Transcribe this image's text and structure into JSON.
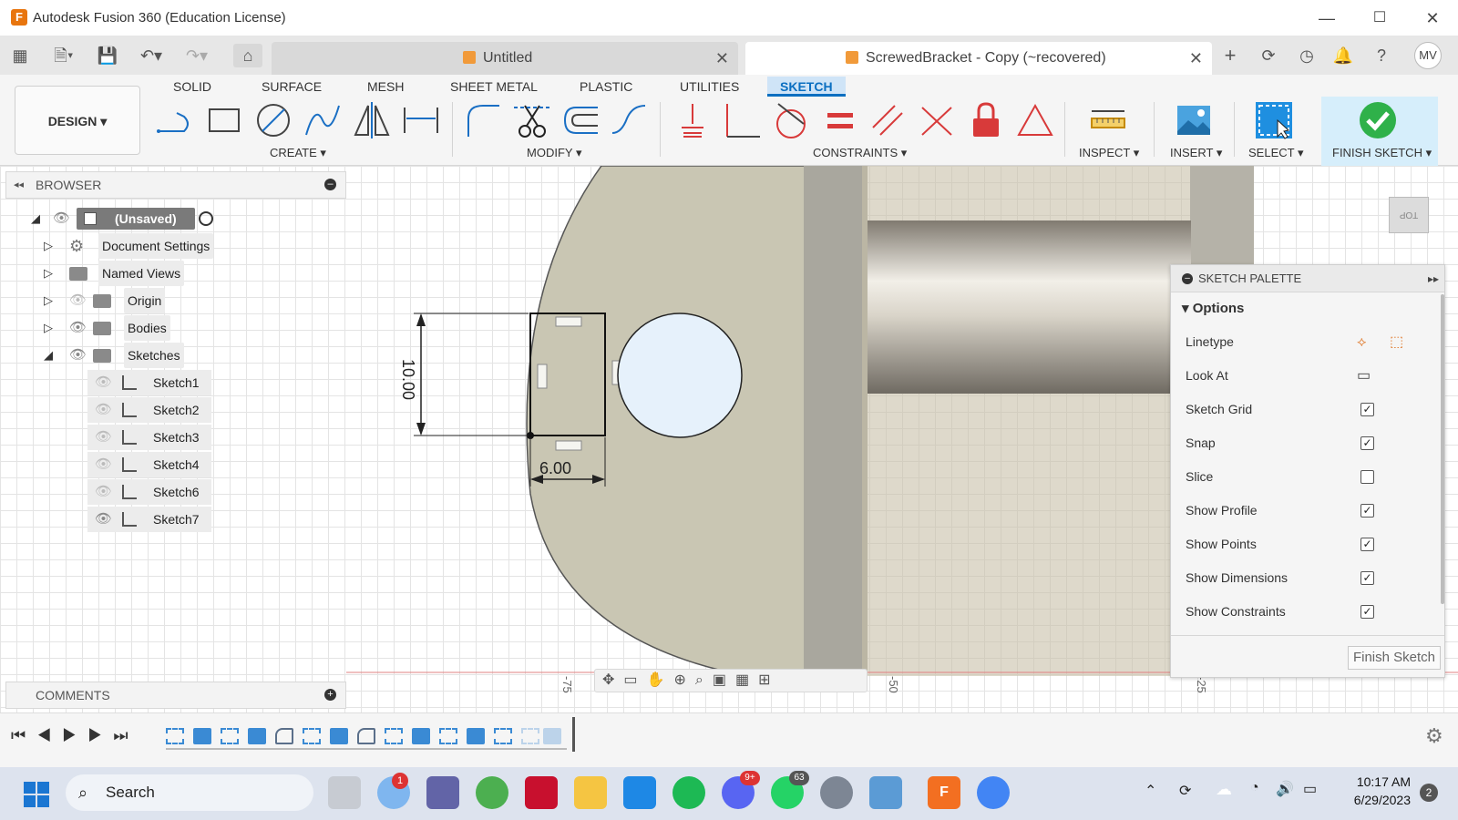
{
  "window": {
    "title": "Autodesk Fusion 360 (Education License)"
  },
  "tabs": [
    {
      "label": "Untitled"
    },
    {
      "label": "ScrewedBracket - Copy (~recovered)"
    }
  ],
  "user": {
    "initials": "MV"
  },
  "workspace": {
    "label": "DESIGN"
  },
  "toolbar_tabs": [
    "SOLID",
    "SURFACE",
    "MESH",
    "SHEET METAL",
    "PLASTIC",
    "UTILITIES",
    "SKETCH"
  ],
  "toolbar_groups": {
    "create": "CREATE",
    "modify": "MODIFY",
    "constraints": "CONSTRAINTS",
    "inspect": "INSPECT",
    "insert": "INSERT",
    "select": "SELECT",
    "finish": "FINISH SKETCH"
  },
  "browser": {
    "title": "BROWSER",
    "root": "(Unsaved)",
    "items": [
      "Document Settings",
      "Named Views",
      "Origin",
      "Bodies",
      "Sketches"
    ],
    "sketches": [
      "Sketch1",
      "Sketch2",
      "Sketch3",
      "Sketch4",
      "Sketch6",
      "Sketch7"
    ]
  },
  "comments": {
    "title": "COMMENTS"
  },
  "dimensions": {
    "height": "10.00",
    "width": "6.00"
  },
  "ruler": {
    "labels": [
      "-75",
      "-50",
      "-25"
    ]
  },
  "viewcube": {
    "label": "TOP"
  },
  "palette": {
    "title": "SKETCH PALETTE",
    "section": "Options",
    "rows": [
      {
        "label": "Linetype",
        "kind": "icons"
      },
      {
        "label": "Look At",
        "kind": "icon"
      },
      {
        "label": "Sketch Grid",
        "kind": "check",
        "checked": true
      },
      {
        "label": "Snap",
        "kind": "check",
        "checked": true
      },
      {
        "label": "Slice",
        "kind": "check",
        "checked": false
      },
      {
        "label": "Show Profile",
        "kind": "check",
        "checked": true
      },
      {
        "label": "Show Points",
        "kind": "check",
        "checked": true
      },
      {
        "label": "Show Dimensions",
        "kind": "check",
        "checked": true
      },
      {
        "label": "Show Constraints",
        "kind": "check",
        "checked": true
      }
    ],
    "finish_button": "Finish Sketch"
  },
  "taskbar": {
    "search": "Search",
    "time": "10:17 AM",
    "date": "6/29/2023",
    "notification_count": "2",
    "badges": {
      "teams": "1",
      "discord": "9+",
      "whatsapp": "63"
    }
  },
  "colors": {
    "accent": "#0b6fc1",
    "part": "#c9c6b3",
    "sketch_active": "#cfe4f7"
  }
}
